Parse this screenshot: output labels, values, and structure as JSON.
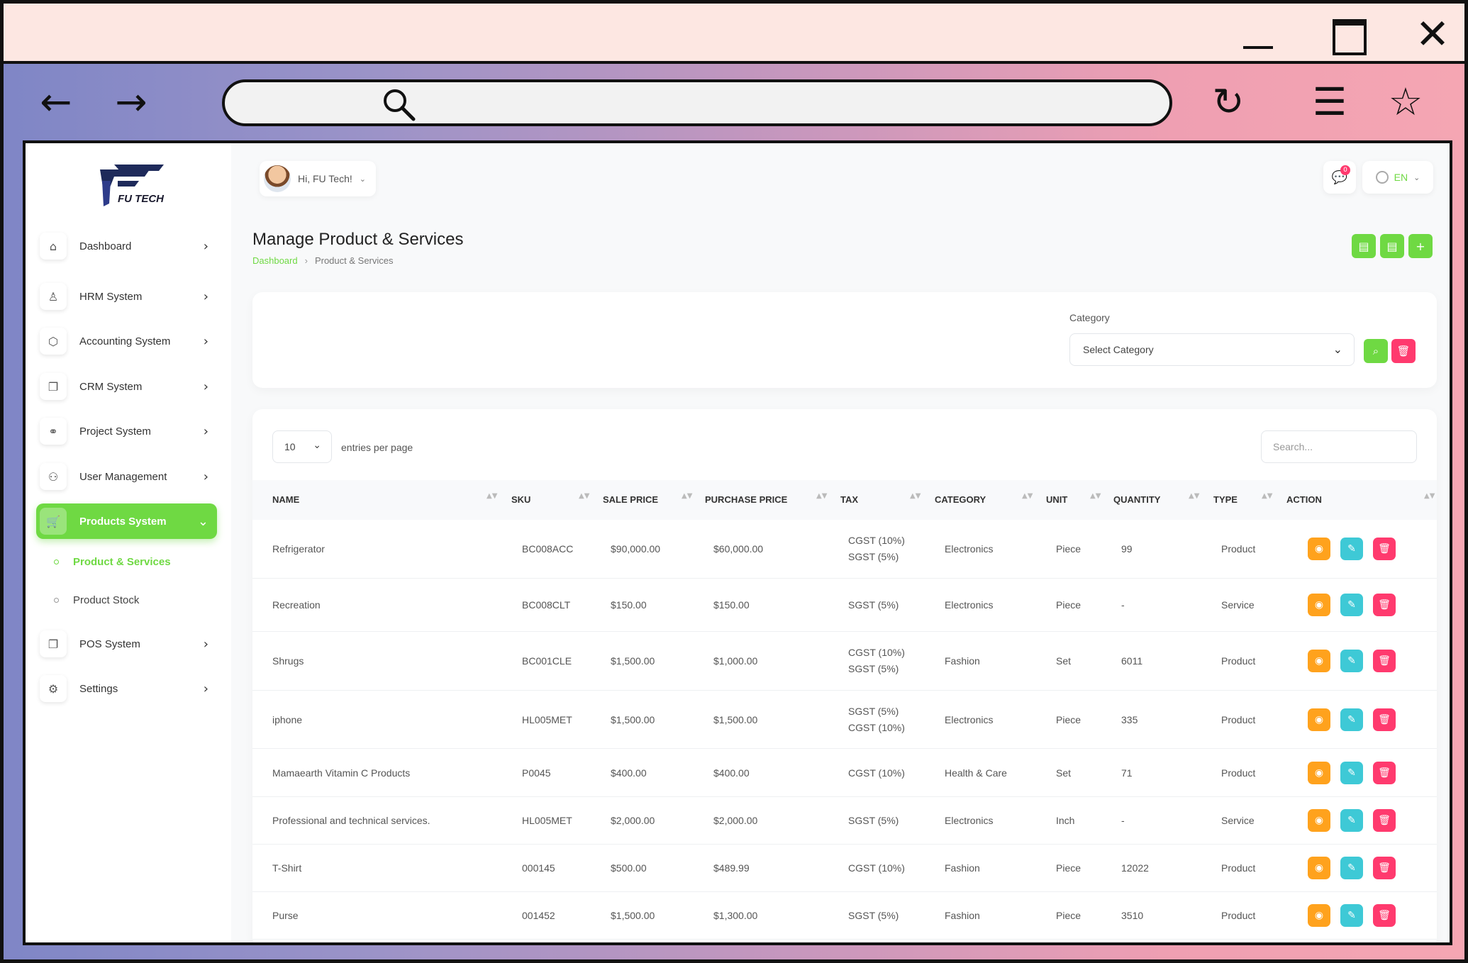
{
  "browser": {
    "minimize_icon": "minimize-icon",
    "maximize_icon": "maximize-icon",
    "close_glyph": "✕",
    "back_glyph": "←",
    "forward_glyph": "→",
    "reload_glyph": "↻",
    "menu_glyph": "☰",
    "star_glyph": "☆"
  },
  "brand": {
    "name": "FU TECH",
    "color": "#1a1a2e",
    "accent": "#6fd943"
  },
  "sidebar": {
    "items": [
      {
        "label": "Dashboard",
        "icon": "⌂",
        "arrow": "›"
      },
      {
        "label": "HRM System",
        "icon": "♙",
        "arrow": "›"
      },
      {
        "label": "Accounting System",
        "icon": "⬡",
        "arrow": "›"
      },
      {
        "label": "CRM System",
        "icon": "❐",
        "arrow": "›"
      },
      {
        "label": "Project System",
        "icon": "⚭",
        "arrow": "›"
      },
      {
        "label": "User Management",
        "icon": "⚇",
        "arrow": "›"
      },
      {
        "label": "Products System",
        "icon": "🛒",
        "arrow": "⌄"
      },
      {
        "label": "POS System",
        "icon": "❐",
        "arrow": "›"
      },
      {
        "label": "Settings",
        "icon": "⚙",
        "arrow": "›"
      }
    ],
    "subitems": [
      {
        "label": "Product & Services"
      },
      {
        "label": "Product Stock"
      }
    ]
  },
  "header": {
    "user_greeting": "Hi, FU Tech!",
    "chevron": "⌄",
    "notification_count": "0",
    "notification_glyph": "💬",
    "language": "EN"
  },
  "page": {
    "title": "Manage Product & Services",
    "breadcrumb": {
      "home": "Dashboard",
      "sep": "›",
      "current": "Product & Services"
    },
    "action_glyphs": [
      "▤",
      "▤",
      "+"
    ]
  },
  "filter": {
    "label": "Category",
    "select_value": "Select Category",
    "caret": "⌄",
    "search_glyph": "⌕",
    "clear_glyph": "🗑"
  },
  "table": {
    "per_page_value": "10",
    "per_page_caret": "⌄",
    "per_page_label": "entries per page",
    "search_placeholder": "Search...",
    "sort_glyph": "▲▼",
    "columns": [
      "NAME",
      "SKU",
      "SALE PRICE",
      "PURCHASE PRICE",
      "TAX",
      "CATEGORY",
      "UNIT",
      "QUANTITY",
      "TYPE",
      "ACTION"
    ],
    "action_glyphs": {
      "view": "◉",
      "edit": "✎",
      "delete": "🗑"
    },
    "rows": [
      {
        "name": "Refrigerator",
        "sku": "BC008ACC",
        "sale": "$90,000.00",
        "purchase": "$60,000.00",
        "tax": "CGST (10%)",
        "tax2": "SGST (5%)",
        "category": "Electronics",
        "unit": "Piece",
        "quantity": "99",
        "type": "Product"
      },
      {
        "name": "Recreation",
        "sku": "BC008CLT",
        "sale": "$150.00",
        "purchase": "$150.00",
        "tax": "SGST (5%)",
        "tax2": "",
        "category": "Electronics",
        "unit": "Piece",
        "quantity": "-",
        "type": "Service"
      },
      {
        "name": "Shrugs",
        "sku": "BC001CLE",
        "sale": "$1,500.00",
        "purchase": "$1,000.00",
        "tax": "CGST (10%)",
        "tax2": "SGST (5%)",
        "category": "Fashion",
        "unit": "Set",
        "quantity": "6011",
        "type": "Product"
      },
      {
        "name": "iphone",
        "sku": "HL005MET",
        "sale": "$1,500.00",
        "purchase": "$1,500.00",
        "tax": "SGST (5%)",
        "tax2": "CGST (10%)",
        "category": "Electronics",
        "unit": "Piece",
        "quantity": "335",
        "type": "Product"
      },
      {
        "name": "Mamaearth Vitamin C Products",
        "sku": "P0045",
        "sale": "$400.00",
        "purchase": "$400.00",
        "tax": "CGST (10%)",
        "tax2": "",
        "category": "Health & Care",
        "unit": "Set",
        "quantity": "71",
        "type": "Product"
      },
      {
        "name": "Professional and technical services.",
        "sku": "HL005MET",
        "sale": "$2,000.00",
        "purchase": "$2,000.00",
        "tax": "SGST (5%)",
        "tax2": "",
        "category": "Electronics",
        "unit": "Inch",
        "quantity": "-",
        "type": "Service"
      },
      {
        "name": "T-Shirt",
        "sku": "000145",
        "sale": "$500.00",
        "purchase": "$489.99",
        "tax": "CGST (10%)",
        "tax2": "",
        "category": "Fashion",
        "unit": "Piece",
        "quantity": "12022",
        "type": "Product"
      },
      {
        "name": "Purse",
        "sku": "001452",
        "sale": "$1,500.00",
        "purchase": "$1,300.00",
        "tax": "SGST (5%)",
        "tax2": "",
        "category": "Fashion",
        "unit": "Piece",
        "quantity": "3510",
        "type": "Product"
      }
    ]
  }
}
